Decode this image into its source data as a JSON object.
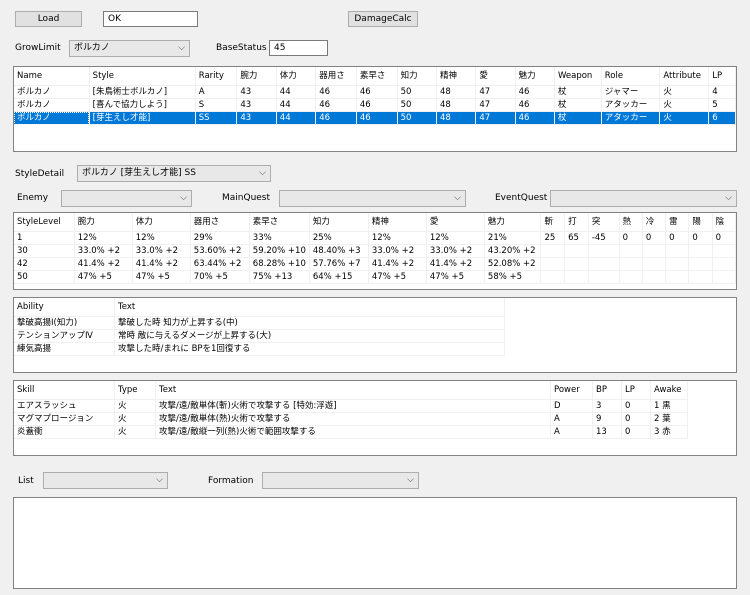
{
  "toolbar": {
    "load_label": "Load",
    "ok_value": "OK",
    "damage_label": "DamageCalc"
  },
  "grow": {
    "label": "GrowLimit",
    "value": "ボルカノ",
    "base_label": "BaseStatus",
    "base_value": "45"
  },
  "style_list": {
    "headers": [
      "Name",
      "Style",
      "Rarity",
      "腕力",
      "体力",
      "器用さ",
      "素早さ",
      "知力",
      "精神",
      "愛",
      "魅力",
      "Weapon",
      "Role",
      "Attribute",
      "LP"
    ],
    "rows": [
      [
        "ボルカノ",
        "[朱鳥術士ボルカノ]",
        "A",
        "43",
        "44",
        "46",
        "46",
        "50",
        "48",
        "47",
        "46",
        "杖",
        "ジャマー",
        "火",
        "4"
      ],
      [
        "ボルカノ",
        "[喜んで協力しよう]",
        "S",
        "43",
        "44",
        "46",
        "46",
        "50",
        "48",
        "47",
        "46",
        "杖",
        "アタッカー",
        "火",
        "5"
      ],
      [
        "ボルカノ",
        "[芽生えし才能]",
        "SS",
        "43",
        "44",
        "46",
        "46",
        "50",
        "48",
        "47",
        "46",
        "杖",
        "アタッカー",
        "火",
        "6"
      ]
    ],
    "selected_row": 2
  },
  "detail": {
    "label": "StyleDetail",
    "value": "ボルカノ [芽生えし才能] SS",
    "enemy_label": "Enemy",
    "mainquest_label": "MainQuest",
    "eventquest_label": "EventQuest"
  },
  "level_table": {
    "headers": [
      "StyleLevel",
      "腕力",
      "体力",
      "器用さ",
      "素早さ",
      "知力",
      "精神",
      "愛",
      "魅力",
      "斬",
      "打",
      "突",
      "熱",
      "冷",
      "雷",
      "陽",
      "陰"
    ],
    "rows": [
      [
        "1",
        "12%",
        "12%",
        "29%",
        "33%",
        "25%",
        "12%",
        "12%",
        "21%",
        "25",
        "65",
        "-45",
        "0",
        "0",
        "0",
        "0",
        "0"
      ],
      [
        "30",
        "33.0% +2",
        "33.0% +2",
        "53.60% +2",
        "59.20% +10",
        "48.40% +3",
        "33.0% +2",
        "33.0% +2",
        "43.20% +2",
        "",
        "",
        "",
        "",
        "",
        "",
        "",
        ""
      ],
      [
        "42",
        "41.4% +2",
        "41.4% +2",
        "63.44% +2",
        "68.28% +10",
        "57.76% +7",
        "41.4% +2",
        "41.4% +2",
        "52.08% +2",
        "",
        "",
        "",
        "",
        "",
        "",
        "",
        ""
      ],
      [
        "50",
        "47% +5",
        "47% +5",
        "70% +5",
        "75% +13",
        "64% +15",
        "47% +5",
        "47% +5",
        "58% +5",
        "",
        "",
        "",
        "",
        "",
        "",
        "",
        ""
      ]
    ]
  },
  "ability_table": {
    "headers": [
      "Ability",
      "Text"
    ],
    "rows": [
      [
        "撃破高揚Ⅰ(知力)",
        "撃破した時 知力が上昇する(中)"
      ],
      [
        "テンションアップⅣ",
        "常時 敵に与えるダメージが上昇する(大)"
      ],
      [
        "練気高揚",
        "攻撃した時/まれに BPを1回復する"
      ]
    ]
  },
  "skill_table": {
    "headers": [
      "Skill",
      "Type",
      "Text",
      "Power",
      "BP",
      "LP",
      "Awake"
    ],
    "rows": [
      [
        "エアスラッシュ",
        "火",
        "攻撃/遠/敵単体(斬)火術で攻撃する [特効:浮遊]",
        "D",
        "3",
        "0",
        "1 黒"
      ],
      [
        "マグマプロージョン",
        "火",
        "攻撃/遠/敵単体(熱)火術で攻撃する",
        "A",
        "9",
        "0",
        "2 葉"
      ],
      [
        "炎蓋衝",
        "火",
        "攻撃/遠/敵縦一列(熱)火術で範囲攻撃する",
        "A",
        "13",
        "0",
        "3 赤"
      ]
    ]
  },
  "bottom": {
    "list_label": "List",
    "formation_label": "Formation"
  },
  "icons": {
    "dropdown": "chevron-down-icon"
  },
  "colors": {
    "selection": "#0078d7"
  }
}
